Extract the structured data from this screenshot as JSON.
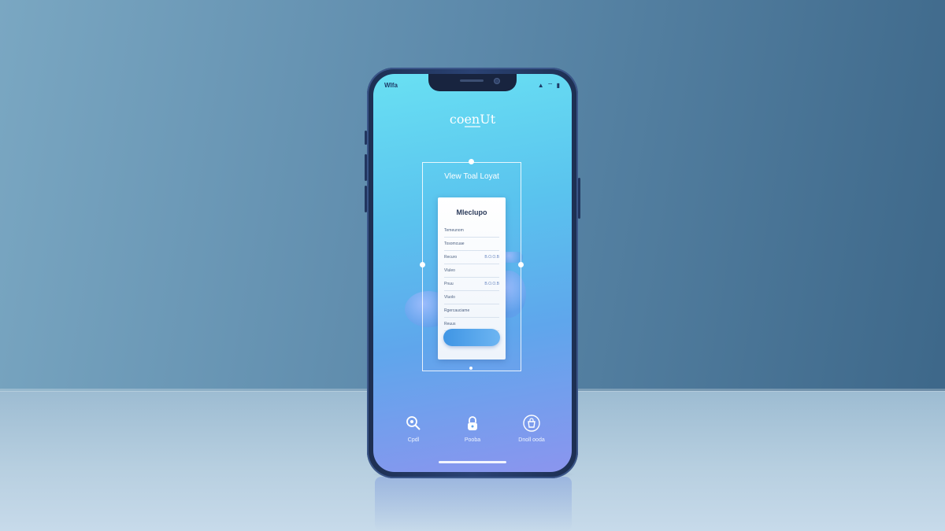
{
  "status_bar": {
    "carrier": "Wlfa",
    "right_icons": "▲ ⌔ ▮"
  },
  "app": {
    "title": "coenUt"
  },
  "frame": {
    "label": "Vlew Toal Loyat"
  },
  "card": {
    "title": "Mleclupo",
    "rows": [
      {
        "label": "Temeunom",
        "value": ""
      },
      {
        "label": "Tosomcuae",
        "value": ""
      },
      {
        "label": "Recuro",
        "value": "B.O.O.B"
      },
      {
        "label": "Vluleo",
        "value": ""
      },
      {
        "label": "Pnuu",
        "value": "B.O.O.B"
      },
      {
        "label": "Vluolo",
        "value": ""
      },
      {
        "label": "Rgercauciame",
        "value": ""
      },
      {
        "label": "Reuus",
        "value": ""
      }
    ],
    "cta_label": ""
  },
  "nav": [
    {
      "label": "Cpdl",
      "icon": "magnifier-icon"
    },
    {
      "label": "Pooba",
      "icon": "lock-icon"
    },
    {
      "label": "Dnoll ooda",
      "icon": "bag-icon"
    }
  ],
  "colors": {
    "accent": "#4a9fe8",
    "screen_top": "#69e0f3",
    "screen_bottom": "#8b95ee"
  }
}
